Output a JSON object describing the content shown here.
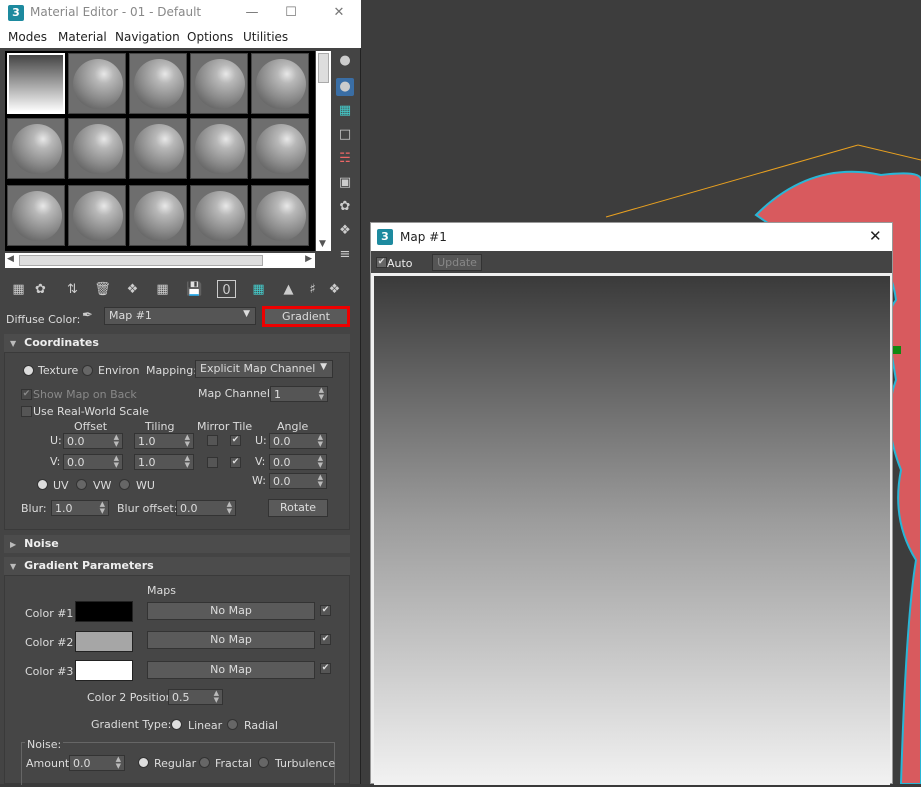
{
  "editor": {
    "title": "Material Editor - 01 - Default",
    "menu": [
      "Modes",
      "Material",
      "Navigation",
      "Options",
      "Utilities"
    ],
    "diffuse_label": "Diffuse Color:",
    "map_name": "Map #1",
    "map_type_button": "Gradient"
  },
  "coordinates": {
    "title": "Coordinates",
    "texture": "Texture",
    "environ": "Environ",
    "mapping_label": "Mapping:",
    "mapping_value": "Explicit Map Channel",
    "show_map_on_back": "Show Map on Back",
    "use_real_world": "Use Real-World Scale",
    "map_channel_label": "Map Channel:",
    "map_channel_value": "1",
    "offset": "Offset",
    "tiling": "Tiling",
    "mirror_tile": "Mirror Tile",
    "angle": "Angle",
    "u": "U:",
    "v": "V:",
    "w": "W:",
    "u_offset": "0.0",
    "v_offset": "0.0",
    "u_tiling": "1.0",
    "v_tiling": "1.0",
    "u_angle": "0.0",
    "v_angle": "0.0",
    "w_angle": "0.0",
    "uv": "UV",
    "vw": "VW",
    "wu": "WU",
    "blur_label": "Blur:",
    "blur_value": "1.0",
    "blur_offset_label": "Blur offset:",
    "blur_offset_value": "0.0",
    "rotate": "Rotate"
  },
  "noise_rollup": {
    "title": "Noise"
  },
  "gradient": {
    "title": "Gradient Parameters",
    "maps_header": "Maps",
    "colors": [
      {
        "label": "Color #1",
        "color": "#000000",
        "map": "No Map"
      },
      {
        "label": "Color #2",
        "color": "#a6a6a6",
        "map": "No Map"
      },
      {
        "label": "Color #3",
        "color": "#ffffff",
        "map": "No Map"
      }
    ],
    "color2_position_label": "Color 2 Position:",
    "color2_position_value": "0.5",
    "gradient_type_label": "Gradient Type:",
    "linear": "Linear",
    "radial": "Radial",
    "noise_label": "Noise:",
    "amount_label": "Amount:",
    "amount_value": "0.0",
    "regular": "Regular",
    "fractal": "Fractal",
    "turbulence": "Turbulence"
  },
  "map_window": {
    "title": "Map #1",
    "auto": "Auto",
    "update": "Update"
  },
  "colors": {
    "highlight": "#e00000",
    "viewport_object": "#d85a5e",
    "selection_outline": "#29b6d6"
  }
}
